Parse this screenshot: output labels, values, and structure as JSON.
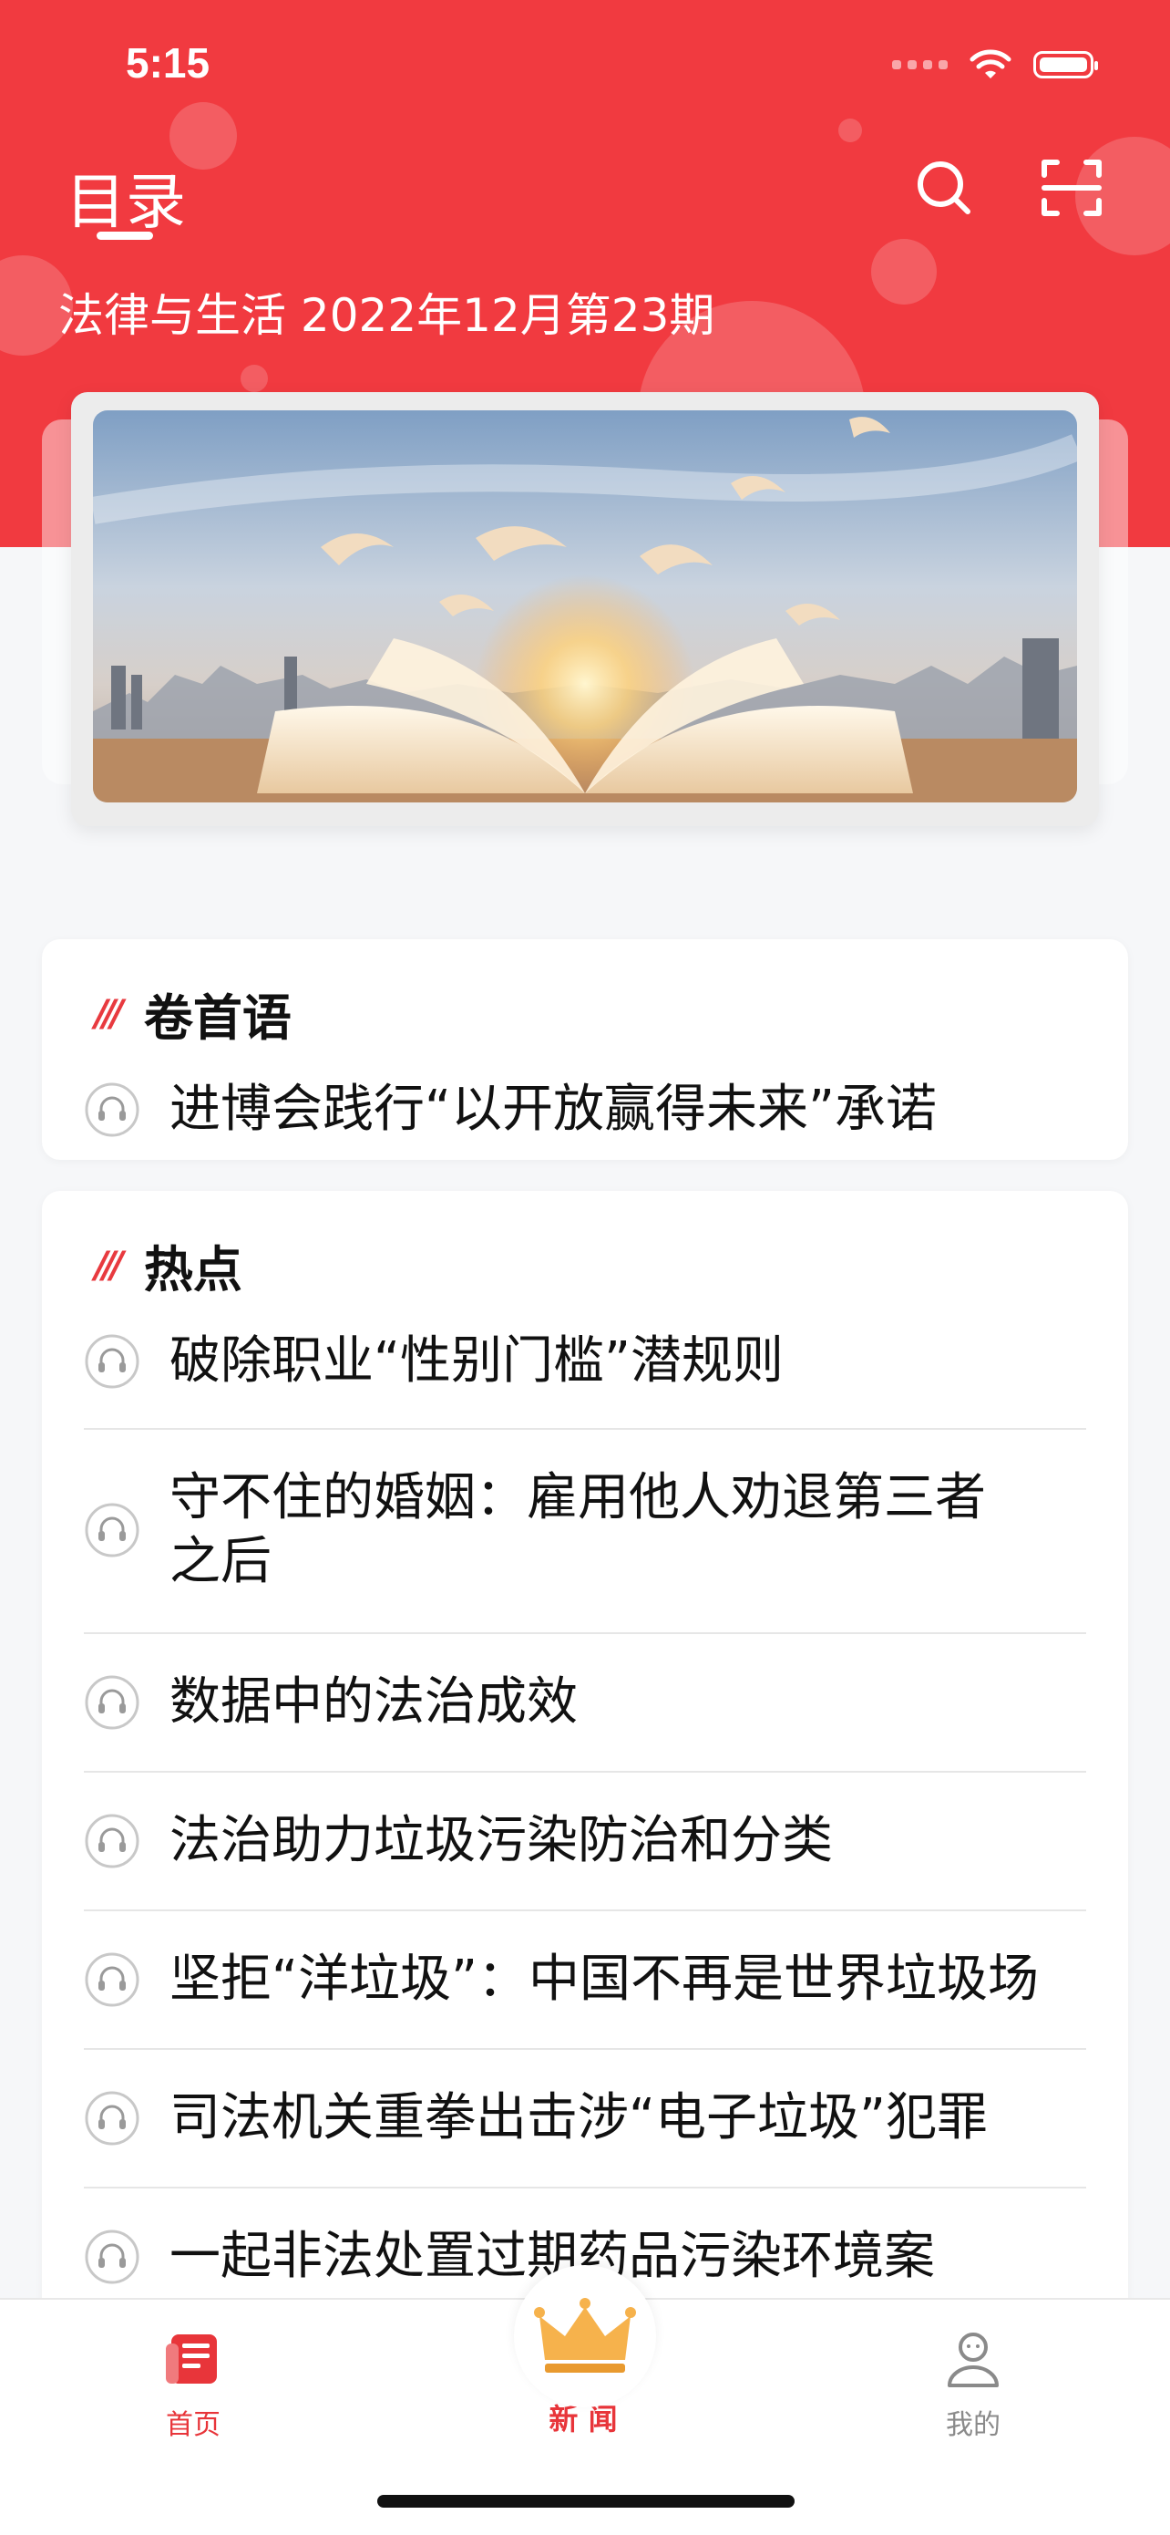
{
  "status_bar": {
    "time": "5:15"
  },
  "header": {
    "title": "目录",
    "issue": "法律与生活 2022年12月第23期",
    "search_icon": "search-icon",
    "scan_icon": "scan-icon"
  },
  "sections": [
    {
      "title": "卷首语",
      "articles": [
        "进博会践行“以开放赢得未来”承诺"
      ]
    },
    {
      "title": "热点",
      "articles": [
        "破除职业“性别门槛”潜规则",
        "守不住的婚姻：雇用他人劝退第三者之后",
        "数据中的法治成效",
        "法治助力垃圾污染防治和分类",
        "坚拒“洋垃圾”：中国不再是世界垃圾场",
        "司法机关重拳出击涉“电子垃圾”犯罪",
        "一起非法处置过期药品污染环境案"
      ]
    }
  ],
  "tabbar": {
    "home": "首页",
    "news": "新 闻",
    "mine": "我的"
  },
  "colors": {
    "brand": "#f13a40",
    "active_tab": "#e8353a",
    "inactive_tab": "#8a8a8a"
  }
}
